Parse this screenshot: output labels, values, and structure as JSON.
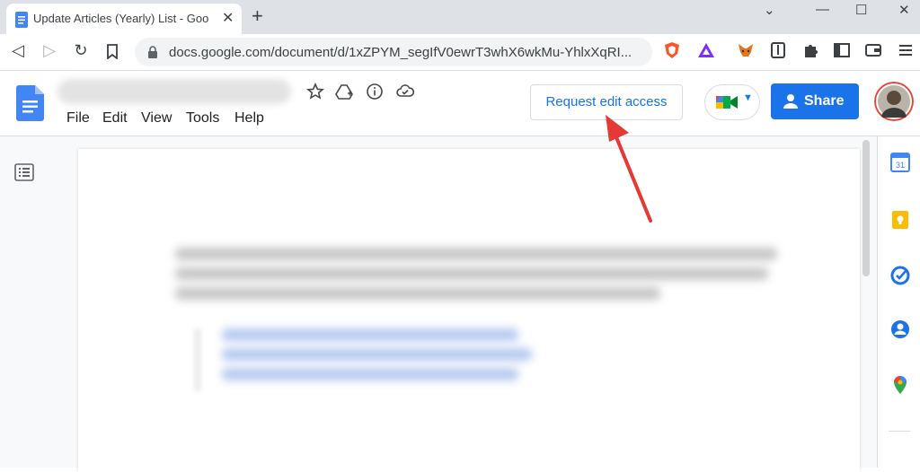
{
  "browser": {
    "tab_title": "Update Articles (Yearly) List - Goo",
    "tab_close": "✕",
    "new_tab": "+",
    "window_controls": {
      "minimize": "—",
      "maximize": "☐",
      "close": "✕",
      "collapse": "⌄"
    },
    "url": "docs.google.com/document/d/1xZPYM_segIfV0ewrT3whX6wkMu-YhlxXqRI...",
    "nav": {
      "back": "◁",
      "forward": "▷",
      "reload": "↻",
      "bookmark": "🔖"
    },
    "extensions": [
      "brave-shield-icon",
      "brave-rewards-icon",
      "metamask-icon",
      "bitwarden-icon",
      "extensions-puzzle-icon",
      "sidebar-icon",
      "wallet-icon",
      "menu-icon"
    ]
  },
  "docs": {
    "menu": [
      "File",
      "Edit",
      "View",
      "Tools",
      "Help"
    ],
    "request_edit_label": "Request edit access",
    "share_label": "Share",
    "header_icons": [
      "star-icon",
      "move-to-drive-icon",
      "details-icon",
      "cloud-status-icon"
    ]
  },
  "side_panel": {
    "icons": [
      "calendar-icon",
      "keep-icon",
      "tasks-icon",
      "contacts-icon",
      "maps-icon"
    ],
    "calendar_day": "31"
  },
  "colors": {
    "accent": "#1a73e8",
    "annotation_arrow": "#e53935"
  }
}
